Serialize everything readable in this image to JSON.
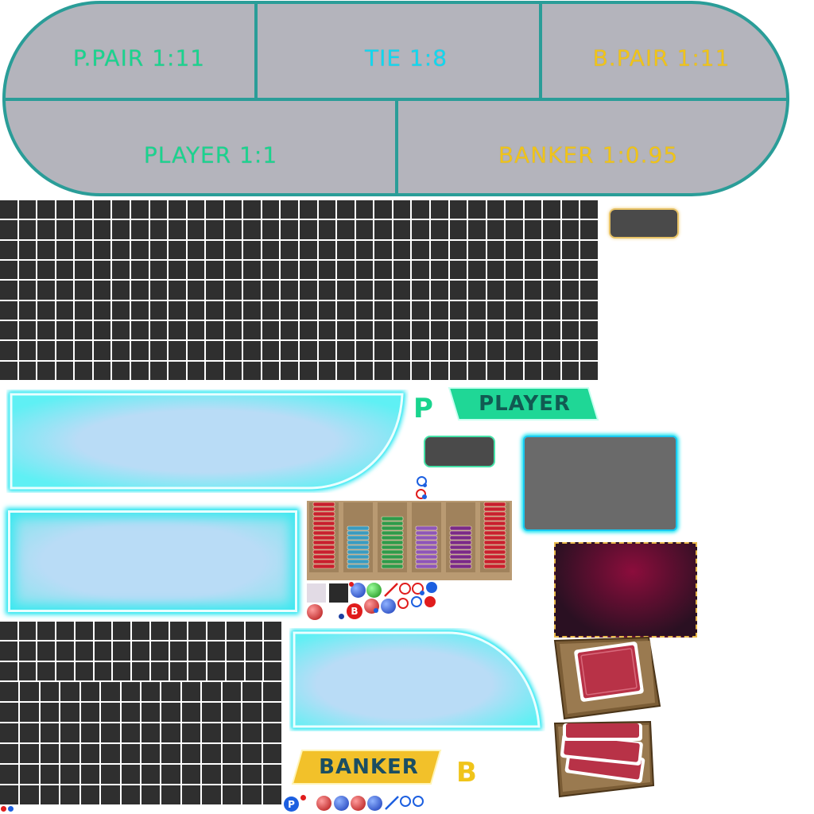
{
  "table": {
    "player_pair": "P.PAIR  1:11",
    "tie": "TIE  1:8",
    "banker_pair": "B.PAIR  1:11",
    "player": "PLAYER  1:1",
    "banker": "BANKER  1:0.95"
  },
  "badges": {
    "player_label": "PLAYER",
    "banker_label": "BANKER",
    "player_letter": "P",
    "banker_letter": "B"
  },
  "markers": {
    "banker_ball_letter": "B",
    "player_ball_letter": "P"
  },
  "colors": {
    "table_fill": "#b4b4bc",
    "table_border": "#2a9d98",
    "player_green": "#19d48e",
    "tie_cyan": "#10d8f0",
    "banker_gold": "#f0c419",
    "grid_cell": "#2f2f2f",
    "glow_cyan": "#18e4f0"
  },
  "chip_rack": {
    "stacks": [
      "red",
      "teal",
      "green",
      "purple",
      "violet",
      "red"
    ]
  }
}
